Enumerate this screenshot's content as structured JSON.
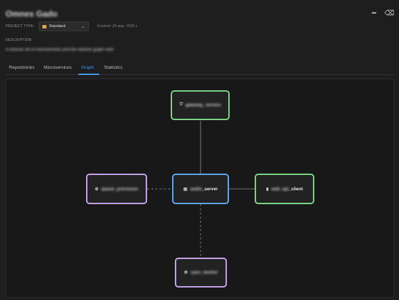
{
  "project": {
    "title": "Omnes Gado",
    "type_label": "PROJECT TYPE:",
    "type_value": "Standard",
    "created": "Created: 29 мар. 2026 г.",
    "description_label": "DESCRIPTION",
    "description_text": "A concise set of microservices and the network graph view"
  },
  "tabs": [
    "Repositories",
    "Microservices",
    "Graph",
    "Statistics"
  ],
  "active_tab": "Graph",
  "graph": {
    "nodes": {
      "gateway": {
        "label": "gateway_service",
        "icon": "shield-icon"
      },
      "server": {
        "label_hidden": "audio",
        "label_suffix": "_server",
        "icon": "server-icon"
      },
      "client": {
        "label_hidden": "web_api",
        "label_suffix": "_client",
        "icon": "client-icon"
      },
      "worker_left": {
        "label": "queue_processor",
        "icon": "gear-icon"
      },
      "worker_bottom": {
        "label": "sync_worker",
        "icon": "gear-icon"
      }
    }
  },
  "colors": {
    "accent": "#3a9cf3",
    "node_green": "#7ed684",
    "node_blue": "#64a6ef",
    "node_purple": "#c7a3ee"
  }
}
